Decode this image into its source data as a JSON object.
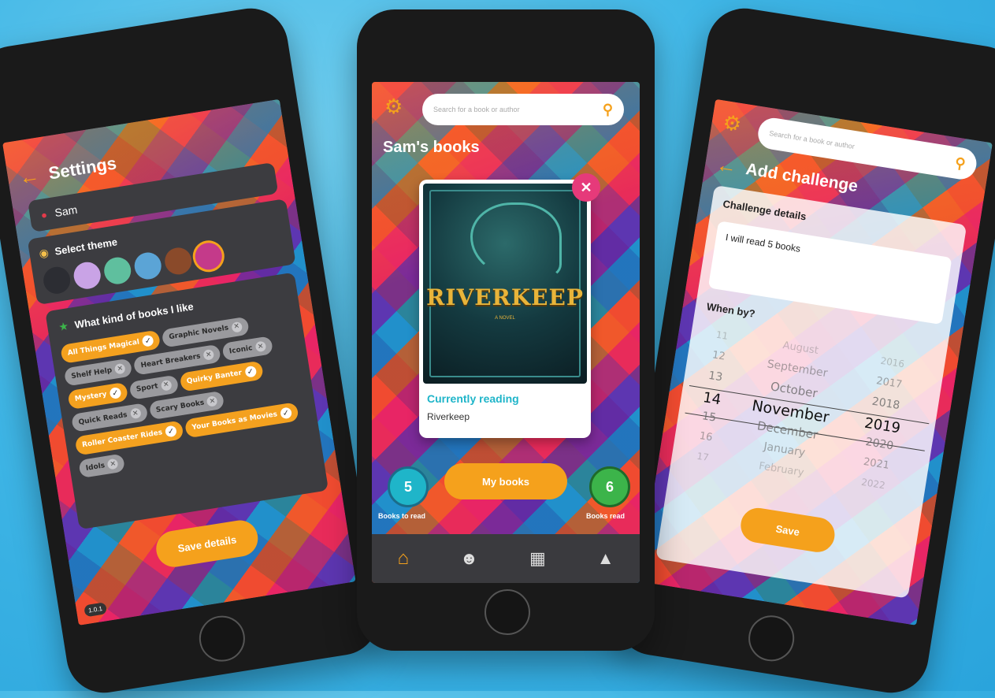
{
  "settings": {
    "title": "Settings",
    "user_name": "Sam",
    "theme_title": "Select theme",
    "themes": [
      "#2c2d33",
      "#c9a3e6",
      "#5fbf9e",
      "#5ba4d6",
      "#8a4a2a",
      "#c43a8a"
    ],
    "kinds_title": "What kind of books I like",
    "chips": [
      {
        "label": "All Things Magical",
        "on": true
      },
      {
        "label": "Graphic Novels",
        "on": false
      },
      {
        "label": "Shelf Help",
        "on": false
      },
      {
        "label": "Heart Breakers",
        "on": false
      },
      {
        "label": "Iconic",
        "on": false
      },
      {
        "label": "Mystery",
        "on": true
      },
      {
        "label": "Sport",
        "on": false
      },
      {
        "label": "Quirky Banter",
        "on": true
      },
      {
        "label": "Quick Reads",
        "on": false
      },
      {
        "label": "Scary Books",
        "on": false
      },
      {
        "label": "Roller Coaster Rides",
        "on": true
      },
      {
        "label": "Your Books as Movies",
        "on": true
      },
      {
        "label": "Idols",
        "on": false
      }
    ],
    "save_label": "Save details",
    "version": "1.0.1"
  },
  "home": {
    "search_placeholder": "Search for a book or author",
    "title": "Sam's books",
    "cover_title": "RIVERKEEP",
    "cover_subtitle": "A NOVEL",
    "status": "Currently reading",
    "book_name": "Riverkeep",
    "to_read_count": "5",
    "to_read_label": "Books to read",
    "read_count": "6",
    "read_label": "Books read",
    "my_books_label": "My books",
    "nav": [
      "home-icon",
      "reader-icon",
      "bookshelf-icon",
      "mountain-flag-icon"
    ]
  },
  "challenge": {
    "search_placeholder": "Search for a book or author",
    "title": "Add challenge",
    "details_label": "Challenge details",
    "details_value": "I will read 5 books",
    "when_label": "When by?",
    "days": [
      "11",
      "12",
      "13",
      "14",
      "15",
      "16",
      "17"
    ],
    "months": [
      "August",
      "September",
      "October",
      "November",
      "December",
      "January",
      "February"
    ],
    "years": [
      "2016",
      "2017",
      "2018",
      "2019",
      "2020",
      "2021",
      "2022"
    ],
    "save_label": "Save"
  },
  "colors": {
    "accent": "#f5a11c",
    "teal": "#1fb5c9",
    "green": "#3cb44a",
    "panel": "#3c3c40"
  }
}
